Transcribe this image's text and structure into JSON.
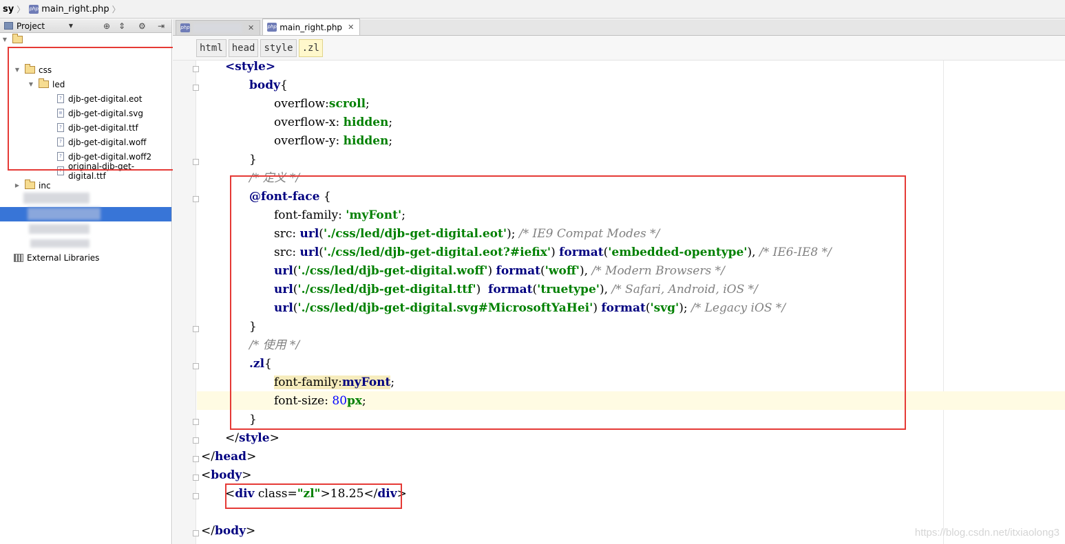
{
  "breadcrumb": {
    "root": "sy",
    "file": "main_right.php",
    "php_badge": "php"
  },
  "project": {
    "view_label": "Project",
    "tree": {
      "css": "css",
      "led": "led",
      "files": [
        "djb-get-digital.eot",
        "djb-get-digital.svg",
        "djb-get-digital.ttf",
        "djb-get-digital.woff",
        "djb-get-digital.woff2",
        "original-djb-get-digital.ttf"
      ],
      "inc": "inc",
      "external_libraries": "External Libraries"
    }
  },
  "editor": {
    "tabs": [
      {
        "label": ""
      },
      {
        "label": "main_right.php"
      }
    ],
    "tag_path": [
      "html",
      "head",
      "style",
      ".zl"
    ],
    "code": {
      "style_open": "<style>",
      "body_sel": "body",
      "overflow_prop": "overflow",
      "overflow_val": "scroll",
      "overflow_x_prop": "overflow-x",
      "overflow_y_prop": "overflow-y",
      "hidden": "hidden",
      "cmt_define": "/* 定义 */",
      "font_face": "@font-face",
      "font_family_prop": "font-family",
      "my_font_str": "'myFont'",
      "src_prop": "src",
      "url_fn": "url",
      "format_fn": "format",
      "eot": "'./css/led/djb-get-digital.eot'",
      "cmt_ie9": "/* IE9 Compat Modes */",
      "eot_fix": "'./css/led/djb-get-digital.eot?#iefix'",
      "embedded": "'embedded-opentype'",
      "cmt_ie6": "/* IE6-IE8 */",
      "woff": "'./css/led/djb-get-digital.woff'",
      "woff_fmt": "'woff'",
      "cmt_modern": "/* Modern Browsers */",
      "ttf": "'./css/led/djb-get-digital.ttf'",
      "truetype": "'truetype'",
      "cmt_safari": "/* Safari, Android, iOS */",
      "svg": "'./css/led/djb-get-digital.svg#MicrosoftYaHei'",
      "svg_fmt": "'svg'",
      "cmt_legacy": "/* Legacy iOS */",
      "cmt_use": "/* 使用 */",
      "zl_sel": ".zl",
      "my_font": "myFont",
      "font_size_prop": "font-size",
      "font_size_num": "80",
      "font_size_unit": "px",
      "style_close_tag": "style",
      "head_close_tag": "head",
      "body_tag": "body",
      "div_tag": "div",
      "class_attr": "class",
      "class_val": "\"zl\"",
      "div_text": "18.25"
    }
  },
  "watermark": "https://blog.csdn.net/itxiaolong3"
}
